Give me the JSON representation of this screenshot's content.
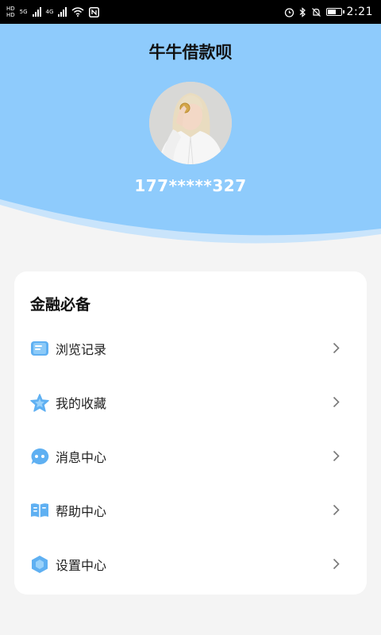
{
  "status_bar": {
    "hd1": "HD",
    "net1": "5G",
    "hd2": "HD",
    "net2": "4G",
    "time": "2:21"
  },
  "header": {
    "title": "牛牛借款呗",
    "phone": "177*****327"
  },
  "card": {
    "title": "金融必备",
    "items": [
      {
        "label": "浏览记录",
        "icon": "document-icon"
      },
      {
        "label": "我的收藏",
        "icon": "star-icon"
      },
      {
        "label": "消息中心",
        "icon": "chat-bubble-icon"
      },
      {
        "label": "帮助中心",
        "icon": "book-icon"
      },
      {
        "label": "设置中心",
        "icon": "hexagon-settings-icon"
      }
    ]
  },
  "colors": {
    "header_blue": "#8ecbfc",
    "wave_light": "#c9e4fb",
    "icon_blue": "#5fb0f2"
  }
}
